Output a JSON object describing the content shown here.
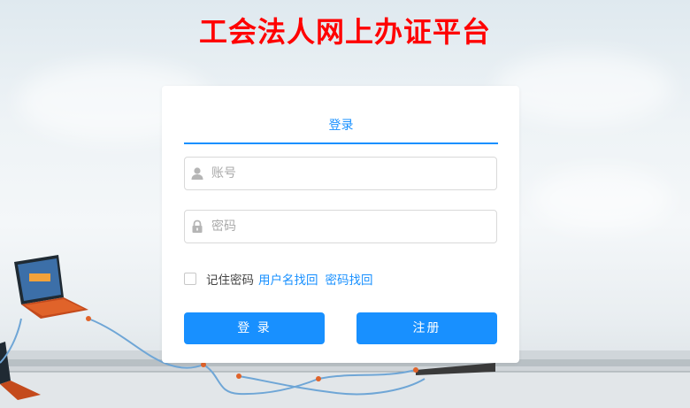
{
  "header": {
    "title": "工会法人网上办证平台"
  },
  "login": {
    "tab_label": "登录",
    "account_placeholder": "账号",
    "password_placeholder": "密码",
    "remember_label": "记住密码",
    "find_username_link": "用户名找回",
    "find_password_link": "密码找回",
    "login_button": "登 录",
    "register_button": "注册"
  },
  "icons": {
    "account": "user-icon",
    "password": "lock-icon"
  },
  "colors": {
    "title": "#ff0000",
    "accent": "#1890ff",
    "link": "#1890ff",
    "card_bg": "#ffffff"
  }
}
